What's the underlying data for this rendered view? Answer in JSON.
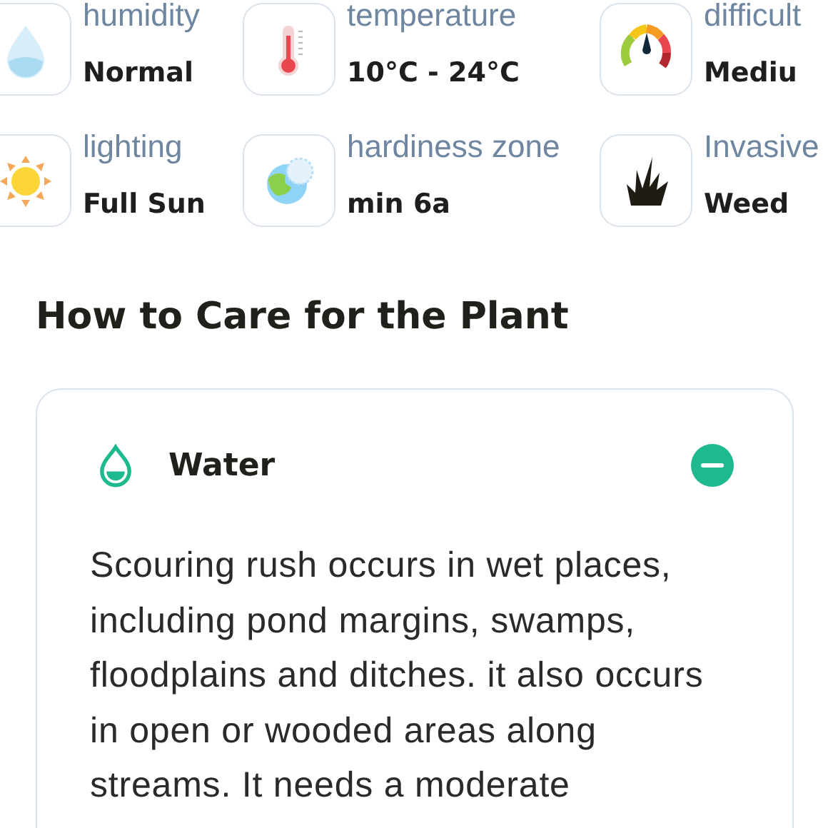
{
  "attributes": [
    {
      "label": "humidity",
      "value": "Normal"
    },
    {
      "label": "temperature",
      "value": "10°C - 24°C"
    },
    {
      "label": "difficult",
      "value": "Mediu"
    },
    {
      "label": "lighting",
      "value": "Full Sun"
    },
    {
      "label": "hardiness zone",
      "value": "min 6a"
    },
    {
      "label": "Invasive",
      "value": "Weed"
    }
  ],
  "care": {
    "heading": "How to Care for the Plant",
    "sections": [
      {
        "title": "Water",
        "expanded": true,
        "text": "Scouring rush occurs in wet places, including pond margins, swamps, floodplains and ditches. it also occurs in open or wooded areas along streams. It needs a moderate"
      }
    ]
  }
}
